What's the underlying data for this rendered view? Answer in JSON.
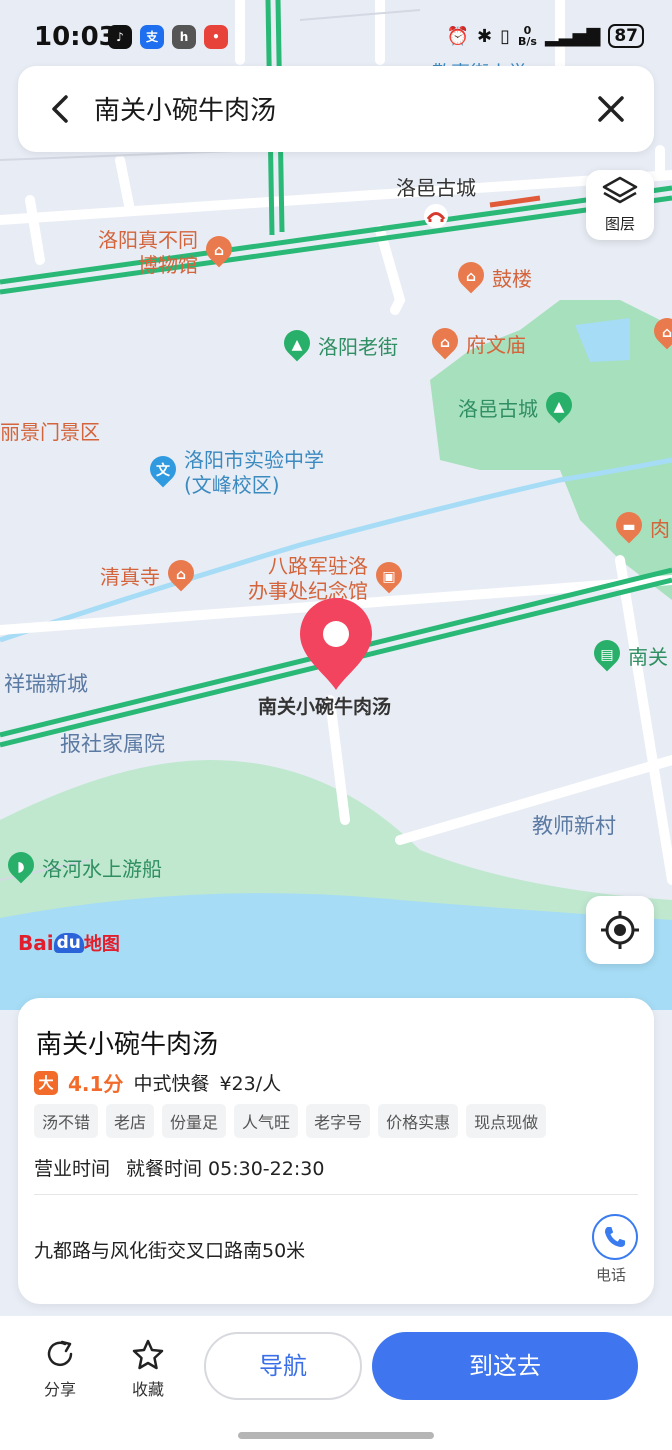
{
  "status_bar": {
    "time": "10:03",
    "net_speed_top": "0",
    "net_speed_unit": "B/s",
    "battery": "87"
  },
  "search": {
    "query": "南关小碗牛肉汤"
  },
  "map": {
    "layer_label": "图层",
    "selected_label": "南关小碗牛肉汤",
    "labels": {
      "luoyi_gate": "洛邑古城",
      "museum_line1": "洛阳真不同",
      "museum_line2": "博物馆",
      "gulou": "鼓楼",
      "laojie": "洛阳老街",
      "fuwenmiao": "府文庙",
      "luoyi_city": "洛邑古城",
      "jingmen": "丽景门景区",
      "school_line1": "洛阳市实验中学",
      "school_line2": "(文峰校区)",
      "rou": "肉",
      "mosque": "清真寺",
      "balujun_line1": "八路军驻洛",
      "balujun_line2": "办事处纪念馆",
      "nanguan": "南关",
      "xiangrui": "祥瑞新城",
      "baoshe": "报社家属院",
      "jiaoshi": "教师新村",
      "boat": "洛河水上游船",
      "partial_top": "敬事街小学"
    },
    "logo": {
      "bai": "Bai",
      "du": "du",
      "ditu": "地图"
    },
    "colors": {
      "road_green": "#2ab877",
      "water": "#a6dcf5",
      "park": "#9fdcb6",
      "pin": "#f2445e"
    }
  },
  "poi": {
    "name": "南关小碗牛肉汤",
    "rating": "4.1分",
    "category": "中式快餐",
    "price": "¥23/人",
    "tags": [
      "汤不错",
      "老店",
      "份量足",
      "人气旺",
      "老字号",
      "价格实惠",
      "现点现做"
    ],
    "hours_label": "营业时间",
    "hours_value": "就餐时间 05:30-22:30",
    "address": "九都路与风化街交叉口路南50米",
    "phone_label": "电话"
  },
  "actions": {
    "share": "分享",
    "favorite": "收藏",
    "navigate": "导航",
    "go_here": "到这去"
  }
}
